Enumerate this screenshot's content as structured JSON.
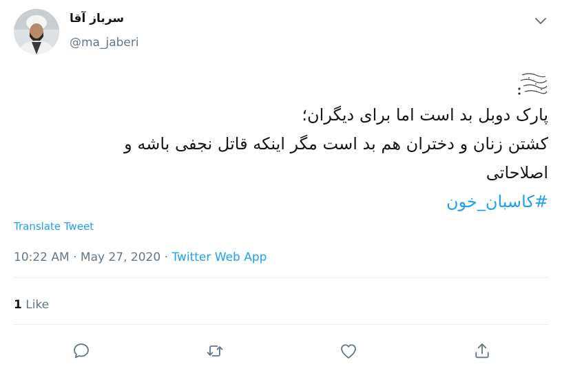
{
  "user": {
    "display_name": "سرباز آقا",
    "handle": "@ma_jaberi"
  },
  "tweet": {
    "lines": [
      "پارک دوبل بد است اما برای دیگران؛",
      "کشتن زنان و دختران هم بد است مگر اینکه قاتل نجفی باشه و",
      "اصلاحاتی"
    ],
    "hashtag": "#کاسبان_خون",
    "translate_label": "Translate Tweet"
  },
  "meta": {
    "time": "10:22 AM",
    "separator1": " · ",
    "date": "May 27, 2020",
    "separator2": " · ",
    "source": "Twitter Web App"
  },
  "stats": {
    "like_count": "1",
    "like_label": "Like"
  },
  "actions": {
    "reply": "reply-icon",
    "retweet": "retweet-icon",
    "like": "heart-icon",
    "share": "share-icon"
  },
  "colors": {
    "link": "#1da1f2",
    "secondary_text": "#657786",
    "primary_text": "#14171a",
    "divider": "#e6ecf0"
  }
}
